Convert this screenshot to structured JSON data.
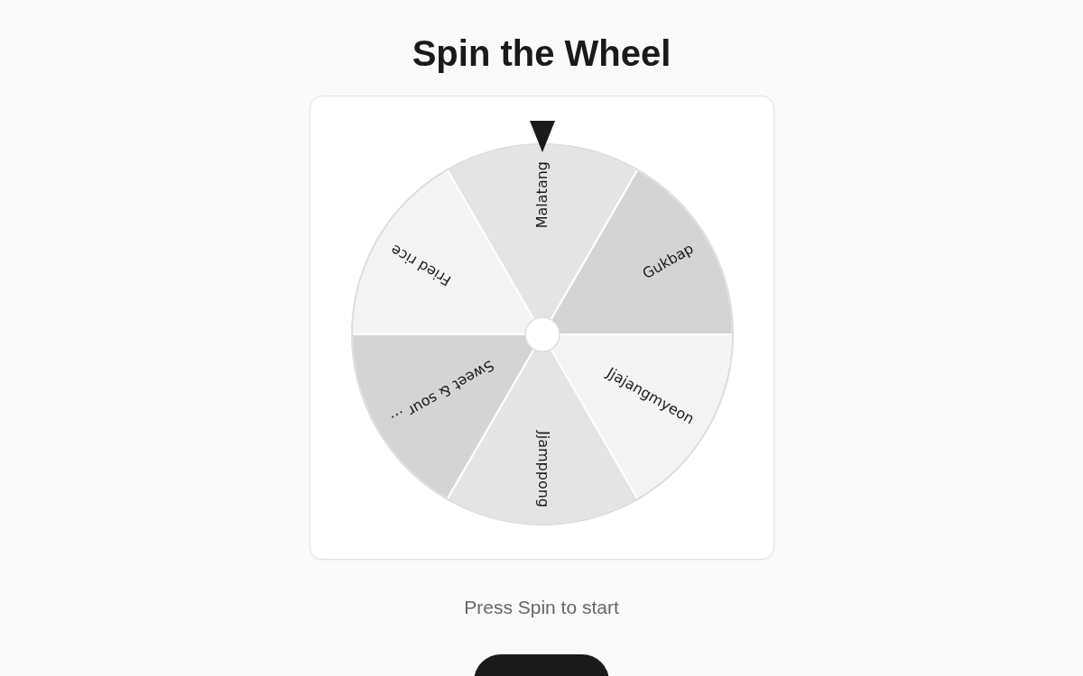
{
  "title": "Spin the Wheel",
  "wheel": {
    "segments": [
      {
        "label": "Malatang",
        "color": "#e4e4e4"
      },
      {
        "label": "Gukbap",
        "color": "#d4d4d4"
      },
      {
        "label": "Jjajangmyeon",
        "color": "#f4f4f4"
      },
      {
        "label": "Jjamppong",
        "color": "#e4e4e4"
      },
      {
        "label": "Sweet & sour …",
        "color": "#d4d4d4"
      },
      {
        "label": "Fried rice",
        "color": "#f4f4f4"
      }
    ]
  },
  "status": "Press Spin to start"
}
